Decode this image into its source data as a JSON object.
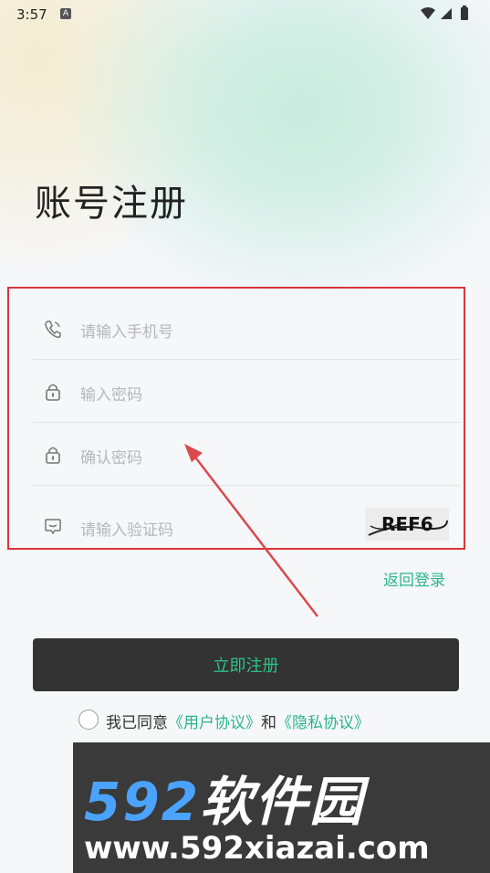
{
  "status_bar": {
    "time": "3:57",
    "notification_icon": "A"
  },
  "page": {
    "title": "账号注册"
  },
  "form": {
    "phone_placeholder": "请输入手机号",
    "password_placeholder": "输入密码",
    "confirm_placeholder": "确认密码",
    "code_placeholder": "请输入验证码",
    "captcha_text": "REF6"
  },
  "actions": {
    "back_login": "返回登录",
    "register": "立即注册"
  },
  "agreement": {
    "prefix": "我已同意",
    "user_agreement": "《用户协议》",
    "and": "和",
    "privacy_policy": "《隐私协议》"
  },
  "watermark": {
    "number": "592",
    "name": "软件园",
    "url": "www.592xiazai.com"
  },
  "colors": {
    "accent": "#2bb58a",
    "button_bg": "#333333",
    "highlight": "#d9353a",
    "arrow": "#d9494d"
  },
  "icons": [
    "phone-icon",
    "lock-icon",
    "message-icon",
    "wifi-icon",
    "signal-icon",
    "battery-icon"
  ]
}
